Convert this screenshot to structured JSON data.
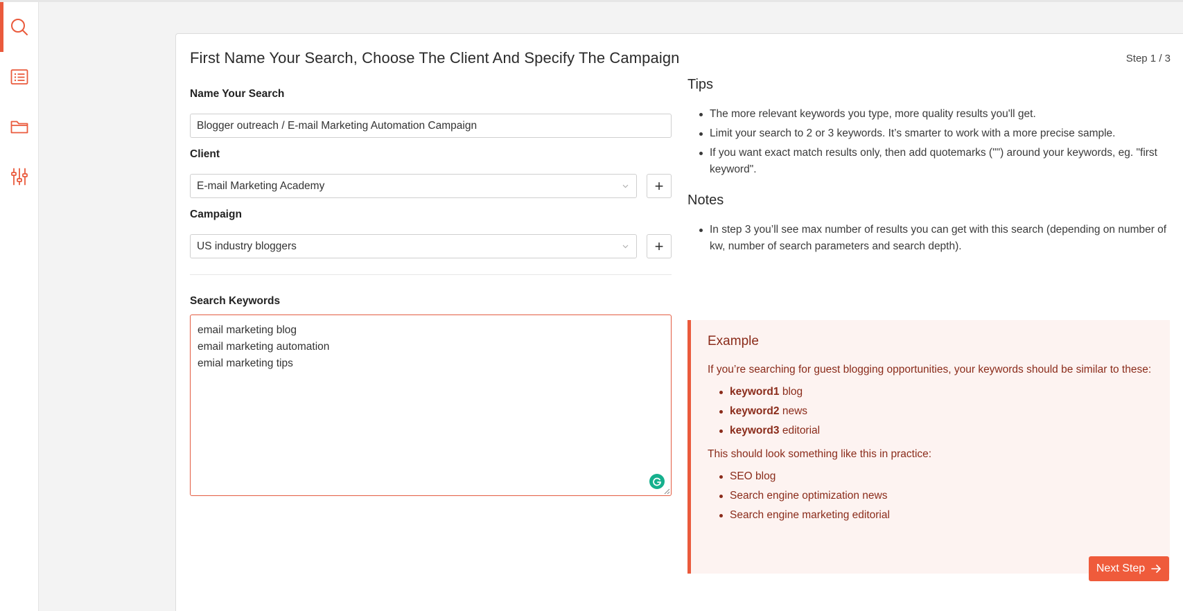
{
  "colors": {
    "accent": "#ea5a3c",
    "example_text": "#8a2b1a",
    "example_bg": "#fdf3f1"
  },
  "sidebar": {
    "items": [
      {
        "icon": "search-icon",
        "active": true
      },
      {
        "icon": "list-icon",
        "active": false
      },
      {
        "icon": "folder-icon",
        "active": false
      },
      {
        "icon": "sliders-icon",
        "active": false
      }
    ]
  },
  "page": {
    "title": "First Name Your Search, Choose The Client And Specify The Campaign",
    "step": "Step 1 / 3"
  },
  "form": {
    "name_label": "Name Your Search",
    "name_value": "Blogger outreach / E-mail Marketing Automation Campaign",
    "client_label": "Client",
    "client_value": "E-mail Marketing Academy",
    "campaign_label": "Campaign",
    "campaign_value": "US industry bloggers",
    "add_label": "+",
    "keywords_label": "Search Keywords",
    "keywords_value": "email marketing blog\nemail marketing automation\nemial marketing tips"
  },
  "tips": {
    "heading": "Tips",
    "items": [
      "The more relevant keywords you type, more quality results you'll get.",
      "Limit your search to 2 or 3 keywords. It’s smarter to work with a more precise sample.",
      "If you want exact match results only, then add quotemarks (\"\") around your keywords, eg. \"first keyword\"."
    ]
  },
  "notes": {
    "heading": "Notes",
    "items": [
      "In step 3 you’ll see max number of results you can get with this search (depending on number of kw, number of search parameters and search depth)."
    ]
  },
  "example": {
    "title": "Example",
    "intro": "If you’re searching for guest blogging opportunities, your keywords should be similar to these:",
    "keywords": [
      {
        "bold": "keyword1",
        "rest": " blog"
      },
      {
        "bold": "keyword2",
        "rest": " news"
      },
      {
        "bold": "keyword3",
        "rest": " editorial"
      }
    ],
    "practice_intro": "This should look something like this in practice:",
    "practice": [
      "SEO blog",
      "Search engine optimization news",
      "Search engine marketing editorial"
    ]
  },
  "next_button": {
    "label": "Next Step"
  }
}
